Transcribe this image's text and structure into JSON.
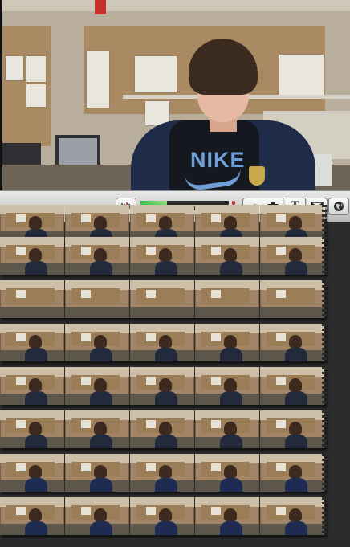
{
  "viewer": {
    "shirt_text": "NIKE"
  },
  "toolbar": {
    "waveform_icon": "waveform-icon",
    "audio_meter_left_level": 0.3,
    "audio_meter_right_level": 0.3,
    "buttons": [
      {
        "name": "music-button",
        "icon": "music-note-icon",
        "glyph": "♫"
      },
      {
        "name": "photo-button",
        "icon": "camera-icon",
        "glyph": "📷"
      },
      {
        "name": "title-button",
        "icon": "title-icon",
        "glyph": "T"
      },
      {
        "name": "transition-button",
        "icon": "transition-icon",
        "glyph": "⧓"
      },
      {
        "name": "map-button",
        "icon": "globe-icon",
        "glyph": "🌐"
      }
    ]
  },
  "filmstrips": {
    "clip_count_per_row": [
      5,
      5,
      5,
      5,
      5,
      5,
      5,
      5
    ]
  }
}
